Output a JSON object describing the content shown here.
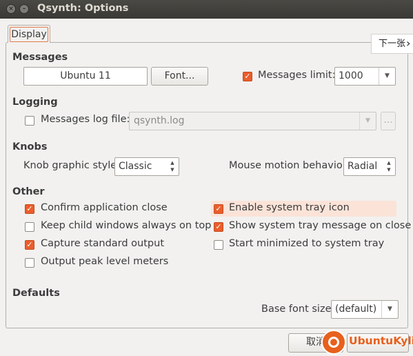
{
  "window": {
    "title": "Qsynth: Options",
    "close_glyph": "×",
    "minimize_glyph": "–"
  },
  "tabs": [
    {
      "label": "Display",
      "selected": true
    }
  ],
  "overlay": {
    "next_page_label": "下一张",
    "next_page_glyph": "›"
  },
  "sections": {
    "messages": {
      "title": "Messages",
      "font_sample": "Ubuntu 11",
      "font_button": "Font...",
      "limit_label": "Messages limit:",
      "limit_checked": true,
      "limit_value": "1000"
    },
    "logging": {
      "title": "Logging",
      "log_file_label": "Messages log file:",
      "log_file_checked": false,
      "log_file_value": "qsynth.log",
      "browse_button": "..."
    },
    "knobs": {
      "title": "Knobs",
      "style_label": "Knob graphic style:",
      "style_value": "Classic",
      "motion_label": "Mouse motion behavior:",
      "motion_value": "Radial"
    },
    "other": {
      "title": "Other",
      "options": [
        {
          "label": "Confirm application close",
          "checked": true
        },
        {
          "label": "Keep child windows always on top",
          "checked": false
        },
        {
          "label": "Capture standard output",
          "checked": true
        },
        {
          "label": "Output peak level meters",
          "checked": false
        },
        {
          "label": "Enable system tray icon",
          "checked": true,
          "highlighted": true
        },
        {
          "label": "Show system tray message on close",
          "checked": true
        },
        {
          "label": "Start minimized to system tray",
          "checked": false
        }
      ]
    },
    "defaults": {
      "title": "Defaults",
      "base_font_label": "Base font size:",
      "base_font_value": "(default)"
    }
  },
  "footer": {
    "cancel_button": "取消",
    "watermark_text": "UbuntuKylin"
  },
  "colors": {
    "accent": "#e95e2c",
    "titlebar": "#3c3b37",
    "highlight": "#fbe3d8",
    "watermark": "#e8601c"
  },
  "icons": {
    "checkmark": "✓",
    "dropdown": "▼",
    "spin_up": "▲",
    "spin_down": "▼"
  }
}
